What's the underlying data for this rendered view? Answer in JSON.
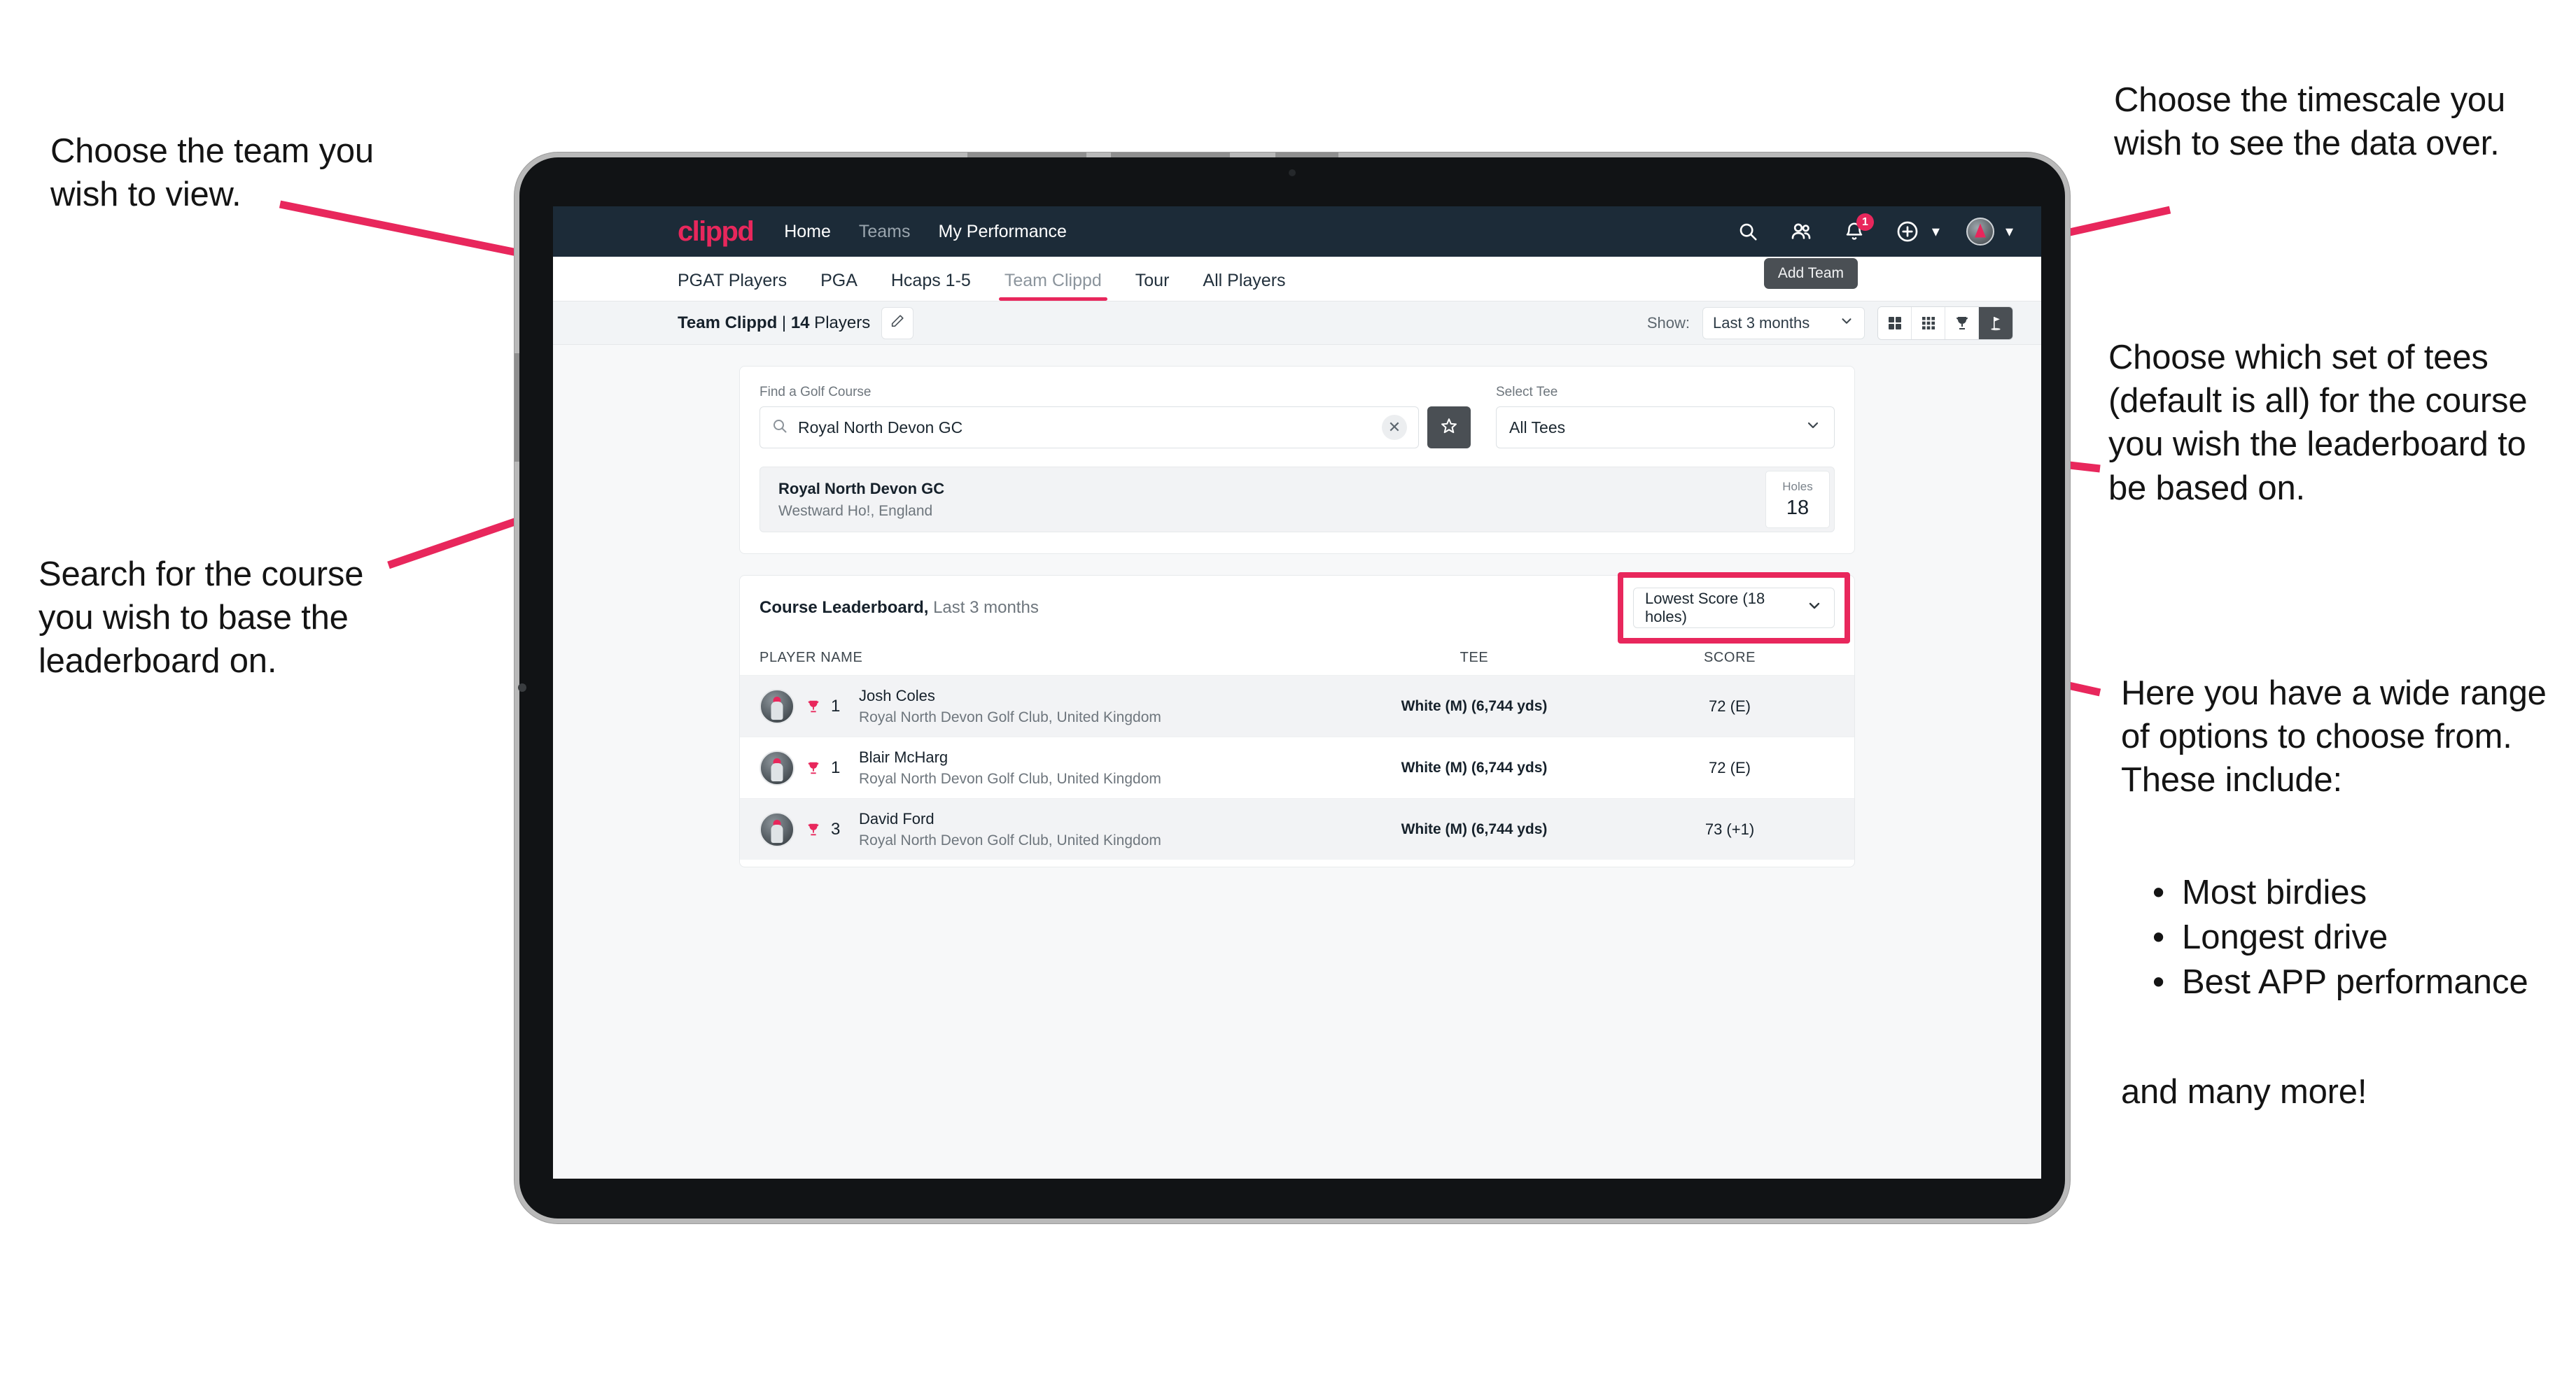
{
  "annotations": {
    "team": "Choose the team you\nwish to view.",
    "search": "Search for the course\nyou wish to base the\nleaderboard on.",
    "timescale": "Choose the timescale you\nwish to see the data over.",
    "tees": "Choose which set of tees\n(default is all) for the course\nyou wish the leaderboard to\nbe based on.",
    "options_intro": "Here you have a wide range\nof options to choose from.\nThese include:",
    "options_list": [
      "Most birdies",
      "Longest drive",
      "Best APP performance"
    ],
    "options_outro": "and many more!"
  },
  "topnav": {
    "brand": "clippd",
    "links": [
      {
        "label": "Home",
        "dim": false
      },
      {
        "label": "Teams",
        "dim": true
      },
      {
        "label": "My Performance",
        "dim": false
      }
    ],
    "icons": [
      {
        "name": "search-icon"
      },
      {
        "name": "people-icon"
      },
      {
        "name": "bell-icon"
      },
      {
        "name": "plus-circle-icon"
      },
      {
        "name": "avatar-icon"
      }
    ],
    "notification_count": "1"
  },
  "tabs": [
    {
      "label": "PGAT Players",
      "active": false,
      "dim": false
    },
    {
      "label": "PGA",
      "active": false,
      "dim": false
    },
    {
      "label": "Hcaps 1-5",
      "active": false,
      "dim": false
    },
    {
      "label": "Team Clippd",
      "active": true,
      "dim": true
    },
    {
      "label": "Tour",
      "active": false,
      "dim": false
    },
    {
      "label": "All Players",
      "active": false,
      "dim": false
    }
  ],
  "tooltip": {
    "add_team": "Add Team"
  },
  "subbar": {
    "team_name": "Team Clippd",
    "separator": " | ",
    "player_count": "14",
    "players_word": " Players",
    "edit_icon": "pencil-icon",
    "show_label": "Show:",
    "show_value": "Last 3 months",
    "view_buttons": [
      {
        "name": "grid-large-view-button",
        "active": false
      },
      {
        "name": "grid-small-view-button",
        "active": false
      },
      {
        "name": "trophy-view-button",
        "active": false
      },
      {
        "name": "golf-flag-view-button",
        "active": true
      }
    ]
  },
  "search": {
    "course_label": "Find a Golf Course",
    "course_value": "Royal North Devon GC",
    "course_placeholder": "Find a Golf Course",
    "clear_icon": "close-icon",
    "favorite_icon": "star-icon",
    "tee_label": "Select Tee",
    "tee_value": "All Tees"
  },
  "course_result": {
    "name": "Royal North Devon GC",
    "location": "Westward Ho!, England",
    "holes_label": "Holes",
    "holes_value": "18"
  },
  "leaderboard": {
    "title": "Course Leaderboard,",
    "subtitle": " Last 3 months",
    "sort_value": "Lowest Score (18 holes)",
    "columns": {
      "name": "PLAYER NAME",
      "tee": "TEE",
      "score": "SCORE"
    },
    "rows": [
      {
        "rank": "1",
        "name": "Josh Coles",
        "club": "Royal North Devon Golf Club, United Kingdom",
        "tee": "White (M) (6,744 yds)",
        "score": "72 (E)"
      },
      {
        "rank": "1",
        "name": "Blair McHarg",
        "club": "Royal North Devon Golf Club, United Kingdom",
        "tee": "White (M) (6,744 yds)",
        "score": "72 (E)"
      },
      {
        "rank": "3",
        "name": "David Ford",
        "club": "Royal North Devon Golf Club, United Kingdom",
        "tee": "White (M) (6,744 yds)",
        "score": "73 (+1)"
      }
    ]
  },
  "colors": {
    "accent_pink": "#e8275c",
    "nav_dark": "#1c2b38",
    "surface": "#f7f8f9",
    "dark_button": "#4a4f54"
  }
}
